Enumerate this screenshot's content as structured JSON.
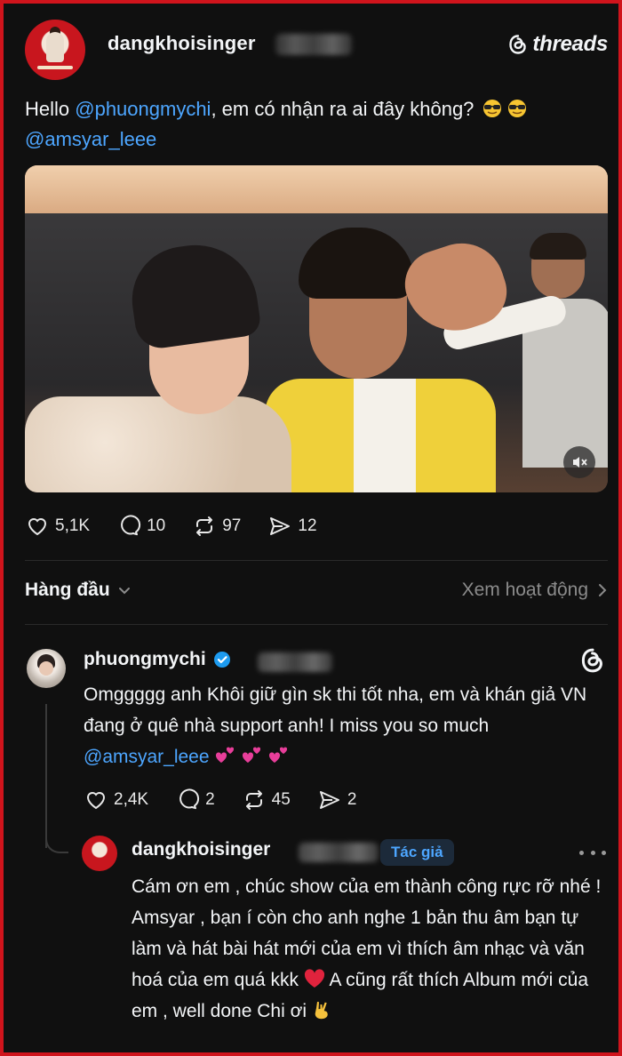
{
  "header": {
    "username": "dangkhoisinger",
    "brand": "threads"
  },
  "post": {
    "text_prefix": "Hello ",
    "mention1": "@phuongmychi",
    "text_middle": ", em có nhận ra ai đây không?",
    "mention2": "@amsyar_leee",
    "emoji_icon": "sunglasses-emoji"
  },
  "post_actions": {
    "likes": "5,1K",
    "comments": "10",
    "reposts": "97",
    "shares": "12"
  },
  "sort": {
    "label": "Hàng đầu",
    "view_activity": "Xem hoạt động"
  },
  "comment": {
    "username": "phuongmychi",
    "text_main": "Omggggg anh Khôi giữ gìn sk thi tốt nha, em và khán giả VN đang ở quê nhà support anh! I miss you so much ",
    "mention": "@amsyar_leee",
    "likes": "2,4K",
    "comments": "2",
    "reposts": "45",
    "shares": "2"
  },
  "reply": {
    "username": "dangkhoisinger",
    "badge": "Tác giả",
    "text_part1": "Cám ơn em , chúc show của em thành công rực rỡ nhé ! Amsyar , bạn í còn cho anh nghe 1 bản thu âm bạn tự làm và hát bài hát mới của em vì thích âm nhạc và văn hoá của em quá kkk ",
    "text_part2": " A cũng rất thích Album mới của em , well done Chi ơi "
  },
  "colors": {
    "frame_border": "#d0141c",
    "background": "#101010",
    "mention": "#4da6ff",
    "verified": "#1d9bf0"
  }
}
